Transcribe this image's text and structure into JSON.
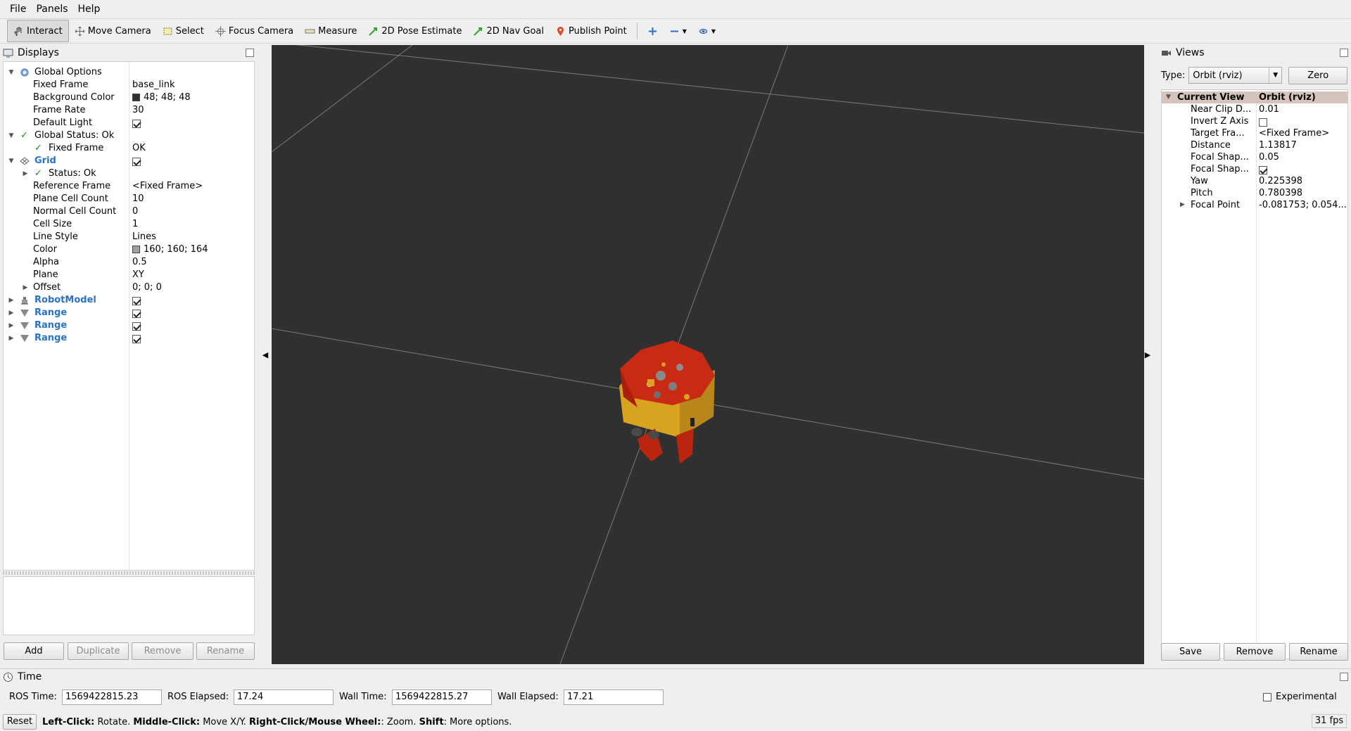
{
  "menu": [
    "File",
    "Panels",
    "Help"
  ],
  "toolbar": {
    "interact": "Interact",
    "move_camera": "Move Camera",
    "select": "Select",
    "focus_camera": "Focus Camera",
    "measure": "Measure",
    "pose_estimate": "2D Pose Estimate",
    "nav_goal": "2D Nav Goal",
    "publish_point": "Publish Point"
  },
  "displays": {
    "title": "Displays",
    "global_options": {
      "label": "Global Options",
      "fixed_frame_label": "Fixed Frame",
      "fixed_frame": "base_link",
      "bg_label": "Background Color",
      "bg": "48; 48; 48",
      "bg_color": "#303030",
      "frame_rate_label": "Frame Rate",
      "frame_rate": "30",
      "default_light_label": "Default Light"
    },
    "global_status": {
      "label": "Global Status: Ok",
      "fixed_frame_label": "Fixed Frame",
      "fixed_frame_value": "OK"
    },
    "grid": {
      "label": "Grid",
      "status": "Status: Ok",
      "ref_frame_label": "Reference Frame",
      "ref_frame": "<Fixed Frame>",
      "plane_cell_label": "Plane Cell Count",
      "plane_cell": "10",
      "normal_cell_label": "Normal Cell Count",
      "normal_cell": "0",
      "cell_size_label": "Cell Size",
      "cell_size": "1",
      "line_style_label": "Line Style",
      "line_style": "Lines",
      "color_label": "Color",
      "color": "160; 160; 164",
      "color_hex": "#a0a0a4",
      "alpha_label": "Alpha",
      "alpha": "0.5",
      "plane_label": "Plane",
      "plane": "XY",
      "offset_label": "Offset",
      "offset": "0; 0; 0"
    },
    "robot_model": "RobotModel",
    "ranges": [
      "Range",
      "Range",
      "Range"
    ],
    "buttons": {
      "add": "Add",
      "duplicate": "Duplicate",
      "remove": "Remove",
      "rename": "Rename"
    }
  },
  "views": {
    "title": "Views",
    "type_label": "Type:",
    "type_value": "Orbit (rviz)",
    "zero": "Zero",
    "current_view_label": "Current View",
    "current_view_value": "Orbit (rviz)",
    "props": [
      {
        "name": "Near Clip D...",
        "value": "0.01"
      },
      {
        "name": "Invert Z Axis",
        "value": ""
      },
      {
        "name": "Target Fra...",
        "value": "<Fixed Frame>"
      },
      {
        "name": "Distance",
        "value": "1.13817"
      },
      {
        "name": "Focal Shap...",
        "value": "0.05"
      },
      {
        "name": "Focal Shap...",
        "value": ""
      },
      {
        "name": "Yaw",
        "value": "0.225398"
      },
      {
        "name": "Pitch",
        "value": "0.780398"
      },
      {
        "name": "Focal Point",
        "value": "-0.081753; 0.054..."
      }
    ],
    "buttons": {
      "save": "Save",
      "remove": "Remove",
      "rename": "Rename"
    }
  },
  "time": {
    "title": "Time",
    "ros_time_label": "ROS Time:",
    "ros_time": "1569422815.23",
    "ros_elapsed_label": "ROS Elapsed:",
    "ros_elapsed": "17.24",
    "wall_time_label": "Wall Time:",
    "wall_time": "1569422815.27",
    "wall_elapsed_label": "Wall Elapsed:",
    "wall_elapsed": "17.21",
    "experimental": "Experimental"
  },
  "status": {
    "reset": "Reset",
    "left_click": "Left-Click:",
    "left_click_desc": "Rotate.",
    "middle_click": "Middle-Click:",
    "middle_click_desc": "Move X/Y.",
    "right_click": "Right-Click/Mouse Wheel:",
    "right_click_desc": ": Zoom.",
    "shift": "Shift",
    "shift_desc": ": More options.",
    "fps": "31 fps"
  }
}
